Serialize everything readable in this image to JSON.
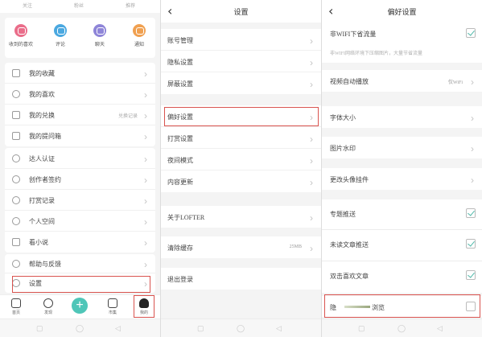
{
  "me": {
    "top_stats": [
      "关注",
      "粉丝",
      "推荐"
    ],
    "quick_actions": [
      {
        "label": "收到的喜欢",
        "icon": "heart-icon",
        "color": "#ea6d8a"
      },
      {
        "label": "评论",
        "icon": "comment-icon",
        "color": "#4aa8e0"
      },
      {
        "label": "聊天",
        "icon": "chat-icon",
        "color": "#8e85d8"
      },
      {
        "label": "通知",
        "icon": "bell-icon",
        "color": "#f0a050"
      }
    ],
    "menu1": [
      {
        "label": "我的收藏",
        "icon": "bookmark-icon"
      },
      {
        "label": "我的喜欢",
        "icon": "heart-outline-icon"
      },
      {
        "label": "我的兑换",
        "icon": "coupon-icon",
        "note": "兑换记录"
      },
      {
        "label": "我的提问箱",
        "icon": "question-box-icon"
      }
    ],
    "menu2": [
      {
        "label": "达人认证",
        "icon": "medal-icon"
      },
      {
        "label": "创作者签约",
        "icon": "sign-icon"
      },
      {
        "label": "打赏记录",
        "icon": "reward-icon"
      },
      {
        "label": "个人空间",
        "icon": "person-icon"
      },
      {
        "label": "看小说",
        "icon": "book-icon"
      }
    ],
    "menu3": [
      {
        "label": "帮助与反馈",
        "icon": "help-icon"
      },
      {
        "label": "设置",
        "icon": "settings-icon"
      }
    ],
    "nav": [
      {
        "label": "首页",
        "icon": "home-icon"
      },
      {
        "label": "发现",
        "icon": "planet-icon"
      },
      {
        "label": "",
        "icon": "plus-icon"
      },
      {
        "label": "市集",
        "icon": "shop-icon"
      },
      {
        "label": "我的",
        "icon": "profile-icon"
      }
    ]
  },
  "settings": {
    "title": "设置",
    "group1": [
      {
        "label": "账号管理"
      },
      {
        "label": "隐私设置"
      },
      {
        "label": "屏蔽设置"
      }
    ],
    "group2": [
      {
        "label": "偏好设置"
      },
      {
        "label": "打赏设置"
      },
      {
        "label": "夜间模式"
      },
      {
        "label": "内容更新"
      }
    ],
    "group3": [
      {
        "label": "关于LOFTER"
      }
    ],
    "group4": [
      {
        "label": "清除缓存",
        "value": "25MB"
      }
    ],
    "group5": [
      {
        "label": "退出登录"
      }
    ]
  },
  "personal": {
    "title": "偏好设置",
    "wifi_label": "非WIFI下省流量",
    "wifi_desc": "非WIFI网络环境下压缩图片，大量节省流量",
    "group2": [
      {
        "label": "视频自动播放",
        "value": "仅WiFi"
      }
    ],
    "group3": [
      {
        "label": "字体大小"
      }
    ],
    "group4": [
      {
        "label": "图片水印"
      }
    ],
    "group5": [
      {
        "label": "更改头像挂件"
      }
    ],
    "checks": [
      {
        "label": "专题推送"
      },
      {
        "label": "未读文章推送"
      },
      {
        "label": "双击喜欢文章"
      }
    ],
    "last_label_a": "隐",
    "last_label_b": "浏览"
  },
  "colors": {
    "accent": "#4fc6b8",
    "highlight": "#d9534f"
  }
}
